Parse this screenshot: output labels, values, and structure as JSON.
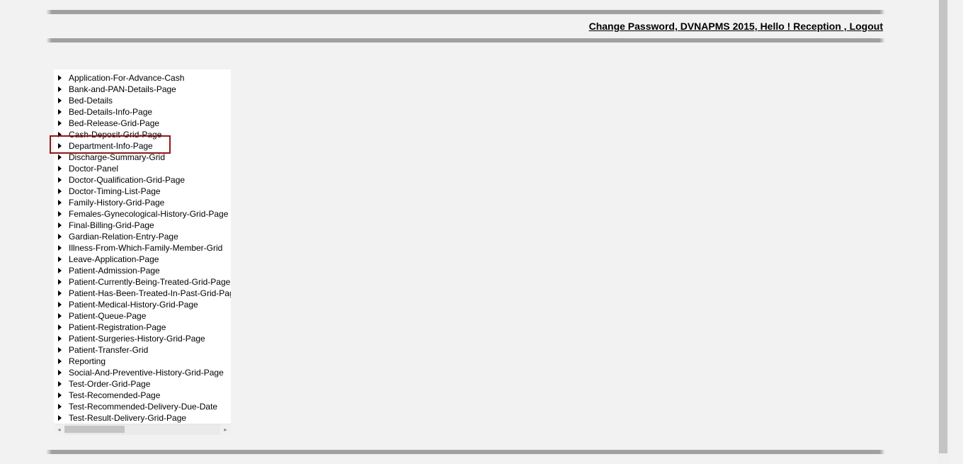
{
  "topbar": {
    "change_password": "Change Password,",
    "brand": "DVNAPMS 2015,",
    "greeting": "Hello ! Reception ,",
    "logout": "Logout"
  },
  "sidebar": {
    "items": [
      "Application-For-Advance-Cash",
      "Bank-and-PAN-Details-Page",
      "Bed-Details",
      "Bed-Details-Info-Page",
      "Bed-Release-Grid-Page",
      "Cash-Deposit-Grid-Page",
      "Department-Info-Page",
      "Discharge-Summary-Grid",
      "Doctor-Panel",
      "Doctor-Qualification-Grid-Page",
      "Doctor-Timing-List-Page",
      "Family-History-Grid-Page",
      "Females-Gynecological-History-Grid-Page",
      "Final-Billing-Grid-Page",
      "Gardian-Relation-Entry-Page",
      "Illness-From-Which-Family-Member-Grid",
      "Leave-Application-Page",
      "Patient-Admission-Page",
      "Patient-Currently-Being-Treated-Grid-Page",
      "Patient-Has-Been-Treated-In-Past-Grid-Page",
      "Patient-Medical-History-Grid-Page",
      "Patient-Queue-Page",
      "Patient-Registration-Page",
      "Patient-Surgeries-History-Grid-Page",
      "Patient-Transfer-Grid",
      "Reporting",
      "Social-And-Preventive-History-Grid-Page",
      "Test-Order-Grid-Page",
      "Test-Recomended-Page",
      "Test-Recommended-Delivery-Due-Date",
      "Test-Result-Delivery-Grid-Page"
    ],
    "highlighted_index": 6
  }
}
